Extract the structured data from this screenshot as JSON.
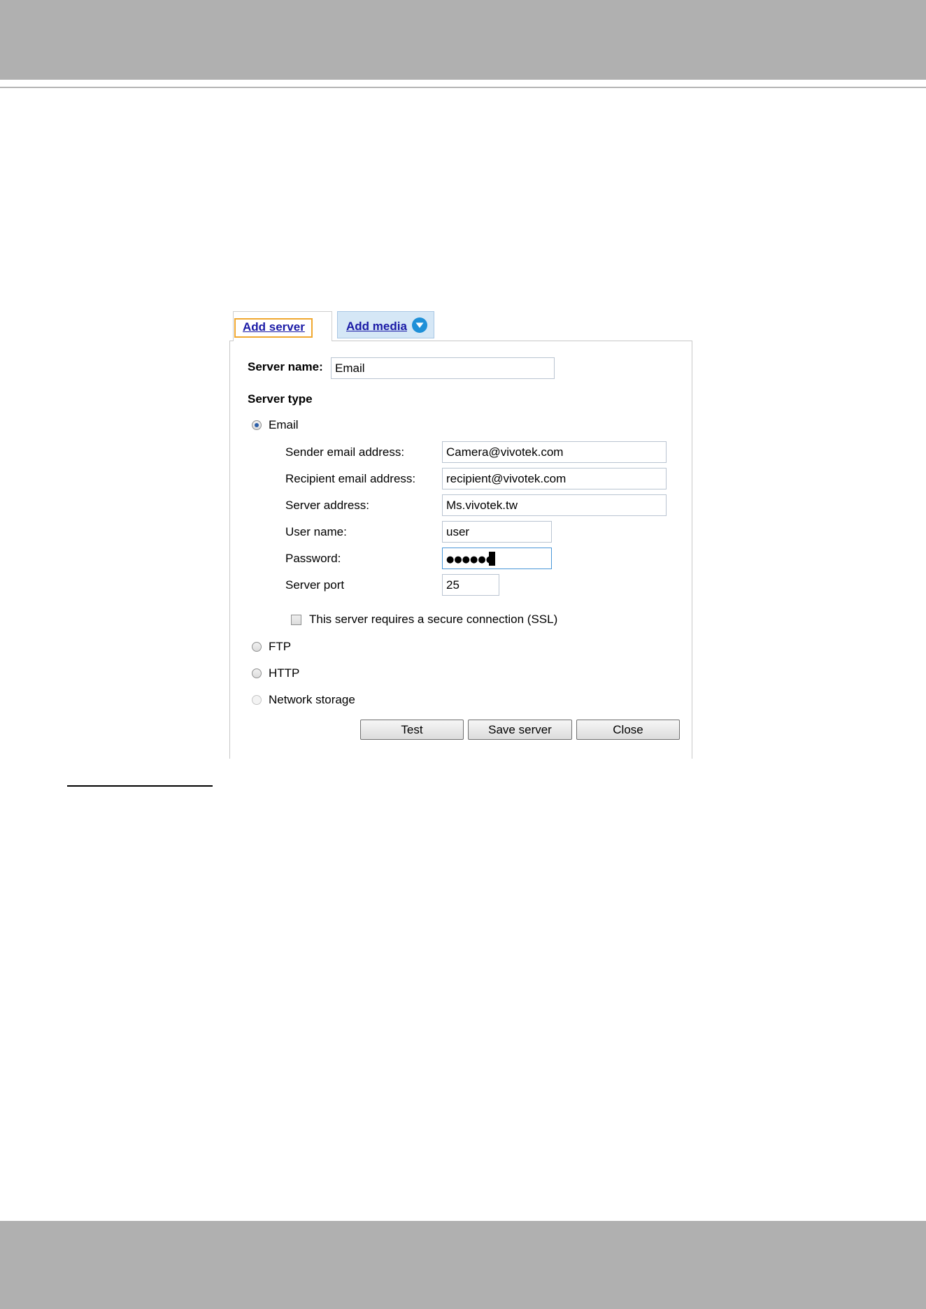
{
  "tabs": {
    "add_server": "Add server",
    "add_media": "Add media"
  },
  "form": {
    "server_name_label": "Server name:",
    "server_name_value": "Email",
    "server_type_label": "Server type",
    "server_types": {
      "email": "Email",
      "ftp": "FTP",
      "http": "HTTP",
      "network_storage": "Network storage"
    },
    "selected_server_type": "Email",
    "email": {
      "sender_label": "Sender email address:",
      "sender_value": "Camera@vivotek.com",
      "recipient_label": "Recipient email address:",
      "recipient_value": "recipient@vivotek.com",
      "server_address_label": "Server address:",
      "server_address_value": "Ms.vivotek.tw",
      "user_name_label": "User name:",
      "user_name_value": "user",
      "password_label": "Password:",
      "password_value": "●●●●●●",
      "server_port_label": "Server port",
      "server_port_value": "25",
      "ssl_label": "This server requires a secure connection (SSL)"
    }
  },
  "buttons": {
    "test": "Test",
    "save_server": "Save server",
    "close": "Close"
  },
  "colors": {
    "page_band": "#b0b0b0",
    "tab_highlight": "#f0a830",
    "link": "#1a1aa6",
    "tab_active_bg": "#d5e7f6",
    "dropdown_icon": "#1e90d8"
  },
  "icons": {
    "add_media_dropdown": "chevron-down-circle-icon"
  }
}
